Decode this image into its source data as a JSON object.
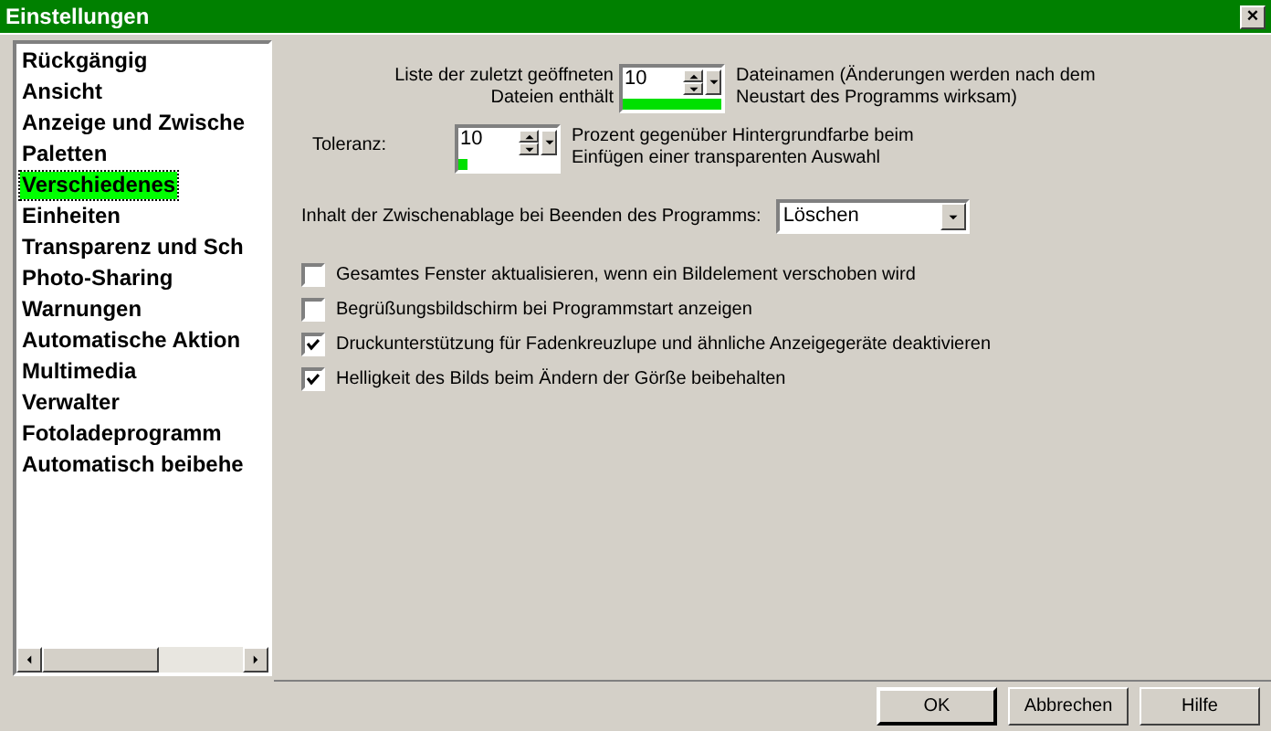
{
  "window": {
    "title": "Einstellungen",
    "close": "×"
  },
  "sidebar": {
    "items": [
      {
        "label": "Rückgängig",
        "selected": false
      },
      {
        "label": "Ansicht",
        "selected": false
      },
      {
        "label": "Anzeige und Zwische",
        "selected": false
      },
      {
        "label": "Paletten",
        "selected": false
      },
      {
        "label": "Verschiedenes",
        "selected": true
      },
      {
        "label": "Einheiten",
        "selected": false
      },
      {
        "label": "Transparenz und Sch",
        "selected": false
      },
      {
        "label": "Photo-Sharing",
        "selected": false
      },
      {
        "label": "Warnungen",
        "selected": false
      },
      {
        "label": "Automatische Aktion",
        "selected": false
      },
      {
        "label": "Multimedia",
        "selected": false
      },
      {
        "label": "Verwalter",
        "selected": false
      },
      {
        "label": "Fotoladeprogramm",
        "selected": false
      },
      {
        "label": "Automatisch beibehe",
        "selected": false
      }
    ]
  },
  "spinners": [
    {
      "label_lines": [
        "Liste der zuletzt geöffneten",
        "Dateien enthält"
      ],
      "value": "10",
      "level": 1,
      "description_lines": [
        "Dateinamen (Änderungen werden nach dem",
        "Neustart des Programms wirksam)"
      ]
    },
    {
      "label_lines": [
        "Toleranz:"
      ],
      "value": "10",
      "level": 0.1,
      "description_lines": [
        "Prozent gegenüber Hintergrundfarbe beim",
        "Einfügen einer transparenten Auswahl"
      ]
    }
  ],
  "clipboard": {
    "label": "Inhalt der Zwischenablage bei Beenden des Programms:",
    "value": "Löschen"
  },
  "checkboxes": [
    {
      "label": "Gesamtes Fenster aktualisieren, wenn ein Bildelement verschoben wird",
      "checked": false
    },
    {
      "label": "Begrüßungsbildschirm bei Programmstart anzeigen",
      "checked": false
    },
    {
      "label": "Druckunterstützung für Fadenkreuzlupe und ähnliche Anzeigegeräte deaktivieren",
      "checked": true
    },
    {
      "label": "Helligkeit des Bilds beim Ändern der Görße beibehalten",
      "checked": true
    }
  ],
  "buttons": [
    "OK",
    "Abbrechen",
    "Hilfe"
  ]
}
